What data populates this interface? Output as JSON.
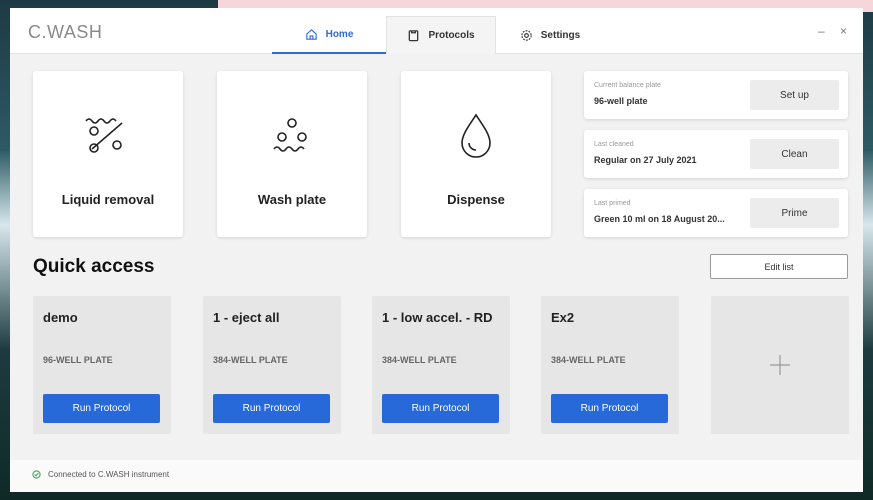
{
  "app": {
    "title": "C.WASH"
  },
  "tabs": [
    {
      "label": "Home",
      "icon": "home-icon",
      "active": true
    },
    {
      "label": "Protocols",
      "icon": "clipboard-icon",
      "active": false
    },
    {
      "label": "Settings",
      "icon": "gear-icon",
      "active": false
    }
  ],
  "window_controls": {
    "minimize": "–",
    "close": "×"
  },
  "actions": [
    {
      "label": "Liquid removal",
      "icon": "liquid-removal-icon"
    },
    {
      "label": "Wash plate",
      "icon": "wash-plate-icon"
    },
    {
      "label": "Dispense",
      "icon": "droplet-icon"
    }
  ],
  "status": [
    {
      "caption": "Current balance plate",
      "value": "96-well plate",
      "button": "Set up"
    },
    {
      "caption": "Last cleaned",
      "value": "Regular on 27 July 2021",
      "button": "Clean"
    },
    {
      "caption": "Last primed",
      "value": "Green 10 ml on 18 August 20...",
      "button": "Prime"
    }
  ],
  "quick_access": {
    "title": "Quick access",
    "edit_label": "Edit list",
    "protocols": [
      {
        "name": "demo",
        "plate": "96-WELL PLATE",
        "run_label": "Run Protocol"
      },
      {
        "name": "1 - eject all",
        "plate": "384-WELL PLATE",
        "run_label": "Run Protocol"
      },
      {
        "name": "1 - low accel. - RD",
        "plate": "384-WELL PLATE",
        "run_label": "Run Protocol"
      },
      {
        "name": "Ex2",
        "plate": "384-WELL PLATE",
        "run_label": "Run Protocol"
      }
    ],
    "add_icon": "plus-icon"
  },
  "footer": {
    "status": "Connected to C.WASH instrument",
    "status_color": "#3aa655"
  },
  "colors": {
    "accent": "#2869d9"
  }
}
